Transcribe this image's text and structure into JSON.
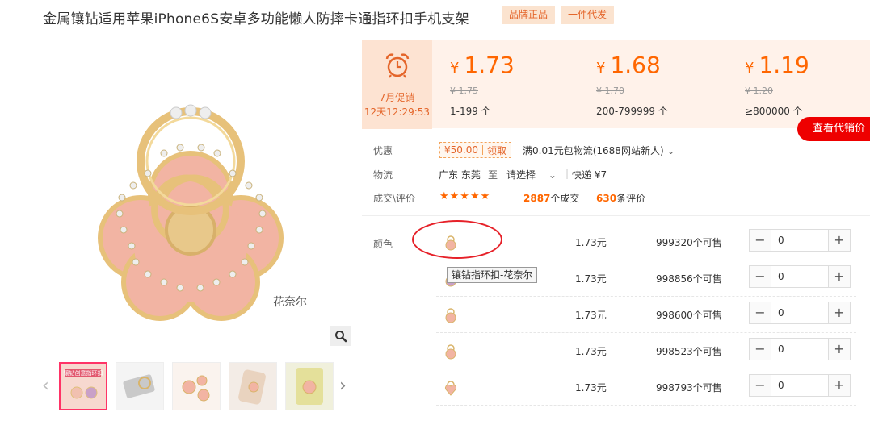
{
  "product": {
    "title": "金属镶钻适用苹果iPhone6S安卓多功能懒人防摔卡通指环扣手机支架",
    "tags": [
      "品牌正品",
      "一件代发"
    ]
  },
  "gallery": {
    "main_image_caption": "花奈尔",
    "zoom_icon": "search-icon",
    "thumbnail_banner_text": "镶钻创意指环扣"
  },
  "promo": {
    "icon": "alarm-clock-icon",
    "title": "7月促销",
    "countdown": "12天12:29:53"
  },
  "price_tiers": [
    {
      "currency": "¥",
      "price": "1.73",
      "original": "¥ 1.75",
      "range": "1-199 个"
    },
    {
      "currency": "¥",
      "price": "1.68",
      "original": "¥ 1.70",
      "range": "200-799999 个"
    },
    {
      "currency": "¥",
      "price": "1.19",
      "original": "¥ 1.20",
      "range": "≥800000 个"
    }
  ],
  "dropship_price_button": "查看代销价",
  "info": {
    "discount_label": "优惠",
    "coupon_amount": "¥50.00",
    "coupon_action": "领取",
    "shipping_promo": "满0.01元包物流(1688网站新人)",
    "logistics_label": "物流",
    "origin": "广东 东莞",
    "to_word": "至",
    "destination": "请选择",
    "express": "快递 ¥7",
    "rating_label": "成交\\评价",
    "stars": "★★★★★",
    "deals_count": "2887",
    "deals_suffix": "个成交",
    "reviews_count": "630",
    "reviews_suffix": "条评价"
  },
  "sku": {
    "color_label": "颜色",
    "tooltip": "镶钻指环扣-花奈尔",
    "rows": [
      {
        "price": "1.73元",
        "stock": "999320个可售",
        "qty": "0"
      },
      {
        "price": "1.73元",
        "stock": "998856个可售",
        "qty": "0"
      },
      {
        "price": "1.73元",
        "stock": "998600个可售",
        "qty": "0"
      },
      {
        "price": "1.73元",
        "stock": "998523个可售",
        "qty": "0"
      },
      {
        "price": "1.73元",
        "stock": "998793个可售",
        "qty": "0"
      }
    ],
    "minus": "−",
    "plus": "+"
  },
  "colors": {
    "accent": "#ff6600",
    "tag_bg": "#fbe3cf",
    "price_bg": "#fff2ea",
    "annotation": "#e62129"
  }
}
